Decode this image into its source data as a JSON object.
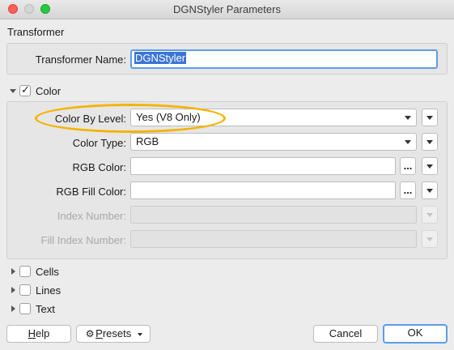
{
  "window": {
    "title": "DGNStyler Parameters"
  },
  "transformer": {
    "section_label": "Transformer",
    "name_label": "Transformer Name:",
    "name_value": "DGNStyler"
  },
  "color": {
    "label": "Color",
    "checked": true,
    "expanded": true,
    "fields": {
      "color_by_level_label": "Color By Level:",
      "color_by_level_value": "Yes (V8 Only)",
      "color_type_label": "Color Type:",
      "color_type_value": "RGB",
      "rgb_color_label": "RGB Color:",
      "rgb_color_value": "",
      "rgb_fill_color_label": "RGB Fill Color:",
      "rgb_fill_color_value": "",
      "index_number_label": "Index Number:",
      "fill_index_number_label": "Fill Index Number:",
      "ellipsis": "..."
    },
    "highlight_color": "#f5b300"
  },
  "sections": [
    {
      "label": "Cells",
      "checked": false,
      "expanded": false
    },
    {
      "label": "Lines",
      "checked": false,
      "expanded": false
    },
    {
      "label": "Text",
      "checked": false,
      "expanded": false
    }
  ],
  "footer": {
    "help_prefix": "",
    "help_underlined": "H",
    "help_rest": "elp",
    "presets_underlined": "P",
    "presets_rest": "resets",
    "cancel_label": "Cancel",
    "ok_label": "OK"
  },
  "colors": {
    "accent": "#5b9ee8",
    "selection": "#3b74d6",
    "close": "#ff5f57",
    "maximize": "#28c840"
  }
}
